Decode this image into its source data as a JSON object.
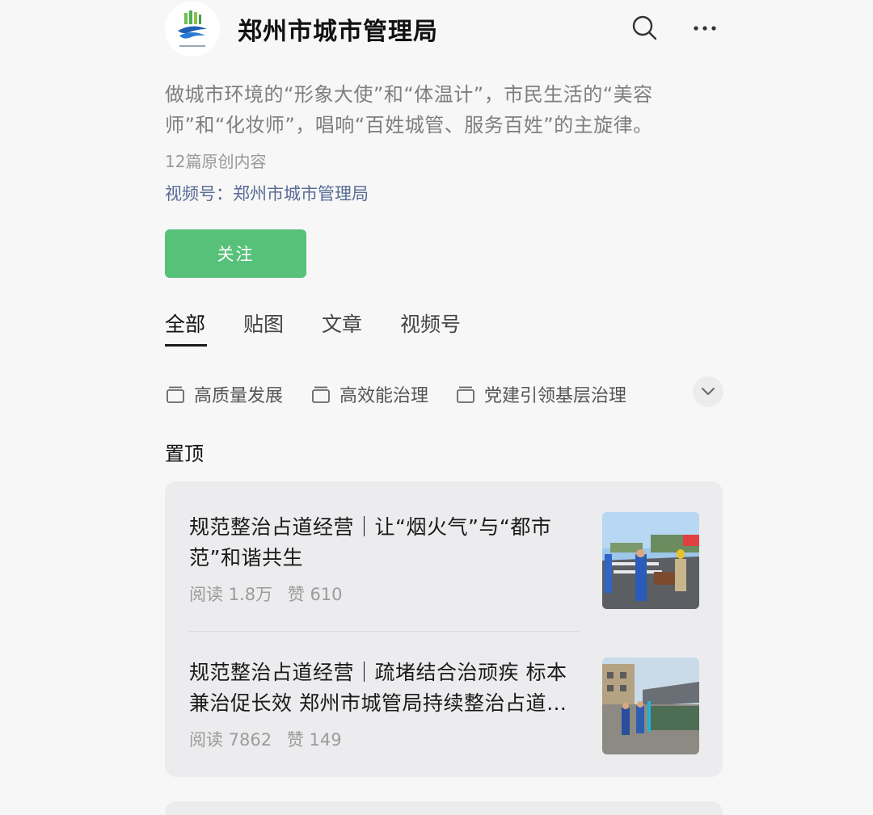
{
  "header": {
    "account_name": "郑州市城市管理局"
  },
  "intro": {
    "description": "做城市环境的“形象大使”和“体温计”，市民生活的“美容师”和“化妆师”，唱响“百姓城管、服务百姓”的主旋律。",
    "article_count": "12篇原创内容",
    "channel_link": "视频号：郑州市城市管理局"
  },
  "follow_button": "关注",
  "tabs": [
    "全部",
    "贴图",
    "文章",
    "视频号"
  ],
  "albums": [
    "高质量发展",
    "高效能治理",
    "党建引领基层治理"
  ],
  "pinned": {
    "title": "置顶",
    "articles": [
      {
        "title": "规范整治占道经营｜让“烟火气”与“都市范”和谐共生",
        "reads": "阅读 1.8万",
        "likes": "赞 610"
      },
      {
        "title": "规范整治占道经营｜疏堵结合治顽疾 标本兼治促长效 郑州市城管局持续整治占道经营",
        "reads": "阅读 7862",
        "likes": "赞 149"
      }
    ]
  },
  "colors": {
    "accent_green": "#57c17a",
    "link_blue": "#576b95",
    "background": "#f7f7f7",
    "card_background": "#ececee"
  }
}
